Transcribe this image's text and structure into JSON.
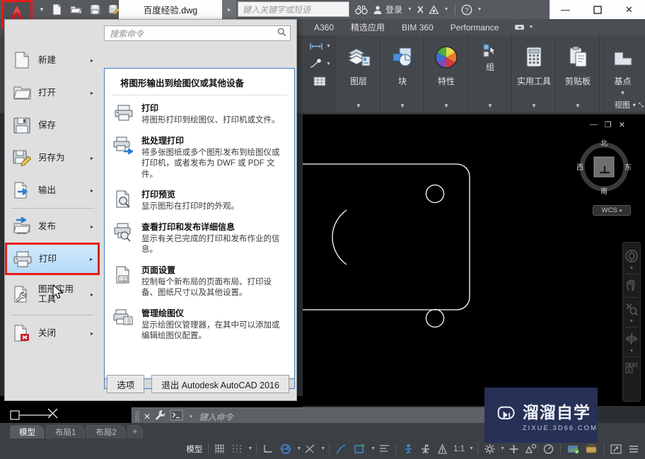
{
  "titlebar": {
    "app_button": "A",
    "quick_access": [
      {
        "name": "new-file",
        "icon": "new-document-icon"
      },
      {
        "name": "open-file",
        "icon": "open-folder-icon"
      },
      {
        "name": "save-file",
        "icon": "floppy-disk-icon"
      },
      {
        "name": "save-as-file",
        "icon": "save-as-icon"
      }
    ],
    "qat_overflow": "▸▸",
    "document_tab": "百度经验.dwg",
    "tab_next_arrow": "▸",
    "search_placeholder": "键入关键字或短语",
    "search_icon": "binoculars-icon",
    "sign_in": "登录",
    "exchange_label": "X",
    "autodesk_icon": "autodesk-triangle-icon",
    "help_label": "?",
    "minimize": "—",
    "maximize": "☐",
    "close": "✕"
  },
  "ribbon_tabs": {
    "items": [
      "A360",
      "精选应用",
      "BIM 360",
      "Performance"
    ],
    "minimize_icon": "ribbon-minimize-icon"
  },
  "ribbon_panels": [
    {
      "label": "图层",
      "icon": "layers-icon"
    },
    {
      "label": "块",
      "icon": "block-icon"
    },
    {
      "label": "特性",
      "icon": "properties-color-wheel-icon"
    },
    {
      "label": "组",
      "icon": "group-icon"
    },
    {
      "label": "实用工具",
      "icon": "calculator-icon"
    },
    {
      "label": "剪贴板",
      "icon": "clipboard-icon"
    },
    {
      "label": "基点",
      "icon": "base-point-icon"
    }
  ],
  "ribbon_view_footer": {
    "label": "视图",
    "caret": "▾",
    "expand": "⤡"
  },
  "app_menu": {
    "search_placeholder": "搜索命令",
    "search_icon": "magnifier-icon",
    "tools": [
      {
        "name": "recent-documents-icon"
      },
      {
        "name": "open-documents-icon"
      }
    ],
    "items": [
      {
        "label": "新建",
        "icon": "new-document-icon",
        "arrow": "▸",
        "selected": false
      },
      {
        "label": "打开",
        "icon": "open-folder-icon",
        "arrow": "▸",
        "selected": false
      },
      {
        "label": "保存",
        "icon": "floppy-disk-icon",
        "arrow": "",
        "selected": false
      },
      {
        "label": "另存为",
        "icon": "save-as-pencil-icon",
        "arrow": "▸",
        "selected": false
      },
      {
        "label": "输出",
        "icon": "export-arrow-icon",
        "arrow": "▸",
        "selected": false
      },
      {
        "label": "发布",
        "icon": "publish-icon",
        "arrow": "▸",
        "selected": false
      },
      {
        "label": "打印",
        "icon": "printer-icon",
        "arrow": "▸",
        "selected": true
      },
      {
        "label": "图形实用\n工具",
        "icon": "wrench-document-icon",
        "arrow": "▸",
        "selected": false
      },
      {
        "label": "关闭",
        "icon": "close-document-icon",
        "arrow": "▸",
        "selected": false
      }
    ],
    "panel_title": "将图形输出到绘图仪或其他设备",
    "entries": [
      {
        "title": "打印",
        "description": "将图形打印到绘图仪、打印机或文件。",
        "icon": "printer-icon"
      },
      {
        "title": "批处理打印",
        "description": "将多张图纸或多个图形发布到绘图仪或打印机，或者发布为 DWF 或 PDF 文件。",
        "icon": "batch-plot-icon"
      },
      {
        "title": "打印预览",
        "description": "显示图形在打印时的外观。",
        "icon": "print-preview-icon"
      },
      {
        "title": "查看打印和发布详细信息",
        "description": "显示有关已完成的打印和发布作业的信息。",
        "icon": "plot-details-icon"
      },
      {
        "title": "页面设置",
        "description": "控制每个新布局的页面布局、打印设备、图纸尺寸以及其他设置。",
        "icon": "page-setup-icon"
      },
      {
        "title": "管理绘图仪",
        "description": "显示绘图仪管理器，在其中可以添加或编辑绘图仪配置。",
        "icon": "manage-plotters-icon"
      }
    ],
    "scroll_down": "▾",
    "options_button": "选项",
    "exit_button": "退出 Autodesk AutoCAD 2016"
  },
  "canvas": {
    "viewport_controls": {
      "minimize": "—",
      "restore": "❐",
      "close": "✕"
    },
    "viewcube": {
      "north": "北",
      "east": "东",
      "south": "南",
      "west": "西",
      "face": "上"
    },
    "wcs_label": "WCS",
    "wcs_caret": "▾",
    "navbar": [
      {
        "name": "steering-wheel-icon"
      },
      {
        "name": "pan-hand-icon"
      },
      {
        "name": "zoom-extents-icon"
      },
      {
        "name": "orbit-icon"
      },
      {
        "name": "showmotion-icon"
      }
    ]
  },
  "watermark": {
    "title": "溜溜自学",
    "subtitle": "ZIXUE.3D66.COM",
    "icon": "play-button-icon",
    "bg": "#273055"
  },
  "command_line": {
    "close_icon": "✕",
    "tools_icon": "wrench-icon",
    "prompt_icon": "➤_",
    "prompt_caret": "▾",
    "placeholder": "键入命令"
  },
  "layout_tabs": {
    "tabs": [
      "模型",
      "布局1",
      "布局2"
    ],
    "active": "模型",
    "add": "+"
  },
  "statusbar": {
    "model_label": "模型",
    "scale": "1:1",
    "items": [
      {
        "name": "grid-display-icon"
      },
      {
        "name": "snap-mode-icon",
        "caret": "▾"
      },
      {
        "name": "ortho-mode-icon"
      },
      {
        "name": "polar-tracking-icon",
        "caret": "▾"
      },
      {
        "name": "object-snap-icon",
        "caret": "▾"
      },
      {
        "name": "osnap-tracking-icon"
      },
      {
        "name": "ucs-icon",
        "caret": "▾"
      },
      {
        "name": "annotation-visibility-icon"
      },
      {
        "name": "annotation-scale-icon"
      },
      {
        "name": "autoscale-icon"
      },
      {
        "name": "workspace-gear-icon",
        "caret": "▾"
      },
      {
        "name": "add-toolbar-icon"
      },
      {
        "name": "hardware-accel-icon"
      },
      {
        "name": "isolate-objects-icon"
      },
      {
        "name": "graphics-perf-icon"
      },
      {
        "name": "clean-screen-icon"
      },
      {
        "name": "fullscreen-icon"
      },
      {
        "name": "customization-icon"
      }
    ]
  }
}
